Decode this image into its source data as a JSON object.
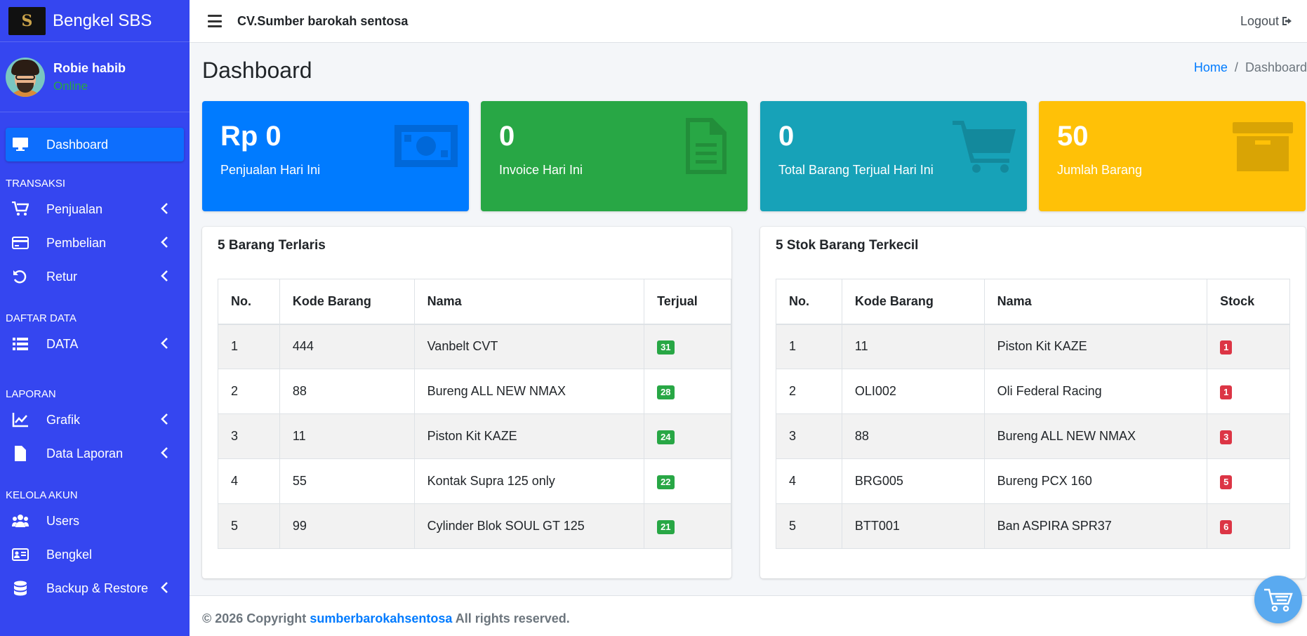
{
  "brand": {
    "logo_text": "S",
    "name": "Bengkel SBS"
  },
  "user": {
    "name": "Robie habib",
    "status": "Online"
  },
  "sidebar": {
    "dashboard": "Dashboard",
    "section_transaksi": "TRANSAKSI",
    "penjualan": "Penjualan",
    "pembelian": "Pembelian",
    "retur": "Retur",
    "section_daftar_data": "DAFTAR DATA",
    "data": "DATA",
    "section_laporan": "LAPORAN",
    "grafik": "Grafik",
    "data_laporan": "Data Laporan",
    "section_kelola_akun": "KELOLA AKUN",
    "users": "Users",
    "bengkel": "Bengkel",
    "backup_restore": "Backup & Restore"
  },
  "topbar": {
    "company": "CV.Sumber barokah sentosa",
    "logout": "Logout"
  },
  "header": {
    "title": "Dashboard",
    "breadcrumb_home": "Home",
    "breadcrumb_sep": "/",
    "breadcrumb_current": "Dashboard"
  },
  "stats": {
    "penjualan": {
      "value": "Rp 0",
      "label": "Penjualan Hari Ini"
    },
    "invoice": {
      "value": "0",
      "label": "Invoice Hari Ini"
    },
    "terjual": {
      "value": "0",
      "label": "Total Barang Terjual Hari Ini"
    },
    "jumlah": {
      "value": "50",
      "label": "Jumlah Barang"
    }
  },
  "terlaris": {
    "title": "5 Barang Terlaris",
    "headers": [
      "No.",
      "Kode Barang",
      "Nama",
      "Terjual"
    ],
    "rows": [
      [
        "1",
        "444",
        "Vanbelt CVT",
        "31"
      ],
      [
        "2",
        "88",
        "Bureng ALL NEW NMAX",
        "28"
      ],
      [
        "3",
        "11",
        "Piston Kit KAZE",
        "24"
      ],
      [
        "4",
        "55",
        "Kontak Supra 125 only",
        "22"
      ],
      [
        "5",
        "99",
        "Cylinder Blok SOUL GT 125",
        "21"
      ]
    ]
  },
  "terkecil": {
    "title": "5 Stok Barang Terkecil",
    "headers": [
      "No.",
      "Kode Barang",
      "Nama",
      "Stock"
    ],
    "rows": [
      [
        "1",
        "11",
        "Piston Kit KAZE",
        "1"
      ],
      [
        "2",
        "OLI002",
        "Oli Federal Racing",
        "1"
      ],
      [
        "3",
        "88",
        "Bureng ALL NEW NMAX",
        "3"
      ],
      [
        "4",
        "BRG005",
        "Bureng PCX 160",
        "5"
      ],
      [
        "5",
        "BTT001",
        "Ban ASPIRA SPR37",
        "6"
      ]
    ]
  },
  "footer": {
    "prefix": "© 2026 Copyright ",
    "link": "sumberbarokahsentosa",
    "suffix": " All rights reserved."
  }
}
